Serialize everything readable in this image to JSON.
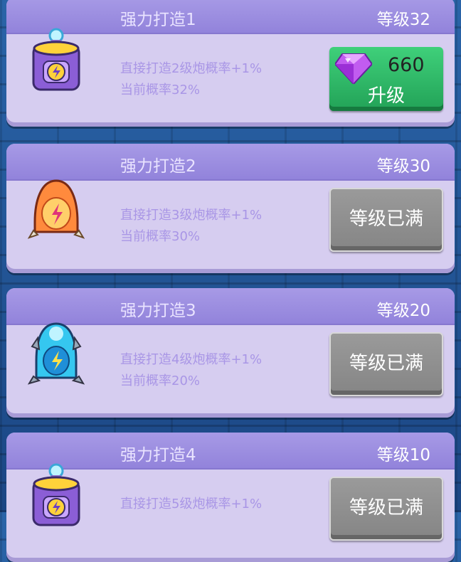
{
  "cards": [
    {
      "title": "强力打造1",
      "level": "等级32",
      "desc": "直接打造2级炮概率+1%",
      "rate": "当前概率32%",
      "button": {
        "type": "upgrade",
        "cost": "660",
        "label": "升级",
        "icon": "gem-icon"
      },
      "icon": "battery-icon"
    },
    {
      "title": "强力打造2",
      "level": "等级30",
      "desc": "直接打造3级炮概率+1%",
      "rate": "当前概率30%",
      "button": {
        "type": "max",
        "label": "等级已满"
      },
      "icon": "red-capsule-icon"
    },
    {
      "title": "强力打造3",
      "level": "等级20",
      "desc": "直接打造4级炮概率+1%",
      "rate": "当前概率20%",
      "button": {
        "type": "max",
        "label": "等级已满"
      },
      "icon": "blue-capsule-icon"
    },
    {
      "title": "强力打造4",
      "level": "等级10",
      "desc": "直接打造5级炮概率+1%",
      "rate": "",
      "button": {
        "type": "max",
        "label": "等级已满"
      },
      "icon": "battery-icon"
    }
  ],
  "colors": {
    "card": "#d6cdf0",
    "header": "#9a8ce0",
    "upgrade": "#2fb866",
    "maxed": "#8e8e8e",
    "gem": "#b04ee6"
  }
}
